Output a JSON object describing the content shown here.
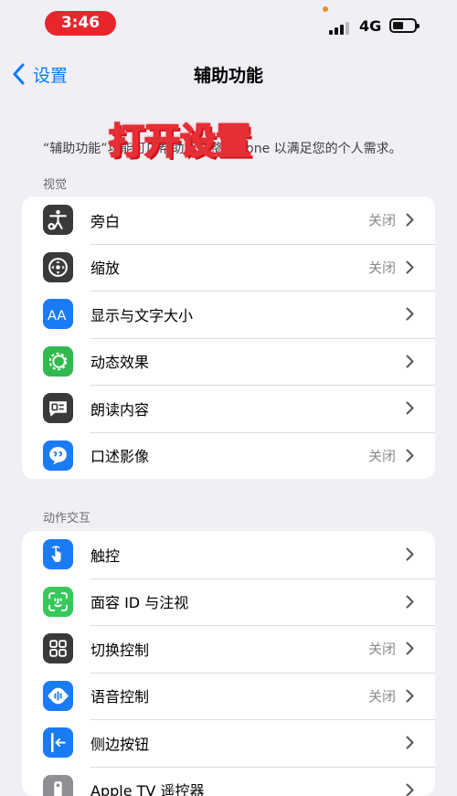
{
  "status": {
    "time": "3:46",
    "network": "4G"
  },
  "nav": {
    "back_label": "设置",
    "title": "辅助功能"
  },
  "description": "“辅助功能”功能可以帮助您调整 iPhone 以满足您的个人需求。",
  "overlay_text": "打开设置",
  "sections": [
    {
      "header": "视觉",
      "items": [
        {
          "label": "旁白",
          "value": "关闭",
          "icon": "voiceover-icon",
          "color": "#3a3a3c"
        },
        {
          "label": "缩放",
          "value": "关闭",
          "icon": "zoom-icon",
          "color": "#3a3a3c"
        },
        {
          "label": "显示与文字大小",
          "value": "",
          "icon": "text-size-icon",
          "color": "#1a7cf5"
        },
        {
          "label": "动态效果",
          "value": "",
          "icon": "motion-icon",
          "color": "#30b94e"
        },
        {
          "label": "朗读内容",
          "value": "",
          "icon": "spoken-content-icon",
          "color": "#3a3a3c"
        },
        {
          "label": "口述影像",
          "value": "关闭",
          "icon": "audio-description-icon",
          "color": "#1a7cf5"
        }
      ]
    },
    {
      "header": "动作交互",
      "items": [
        {
          "label": "触控",
          "value": "",
          "icon": "touch-icon",
          "color": "#1a7cf5"
        },
        {
          "label": "面容 ID 与注视",
          "value": "",
          "icon": "face-id-icon",
          "color": "#36c95a"
        },
        {
          "label": "切换控制",
          "value": "关闭",
          "icon": "switch-control-icon",
          "color": "#3a3a3c"
        },
        {
          "label": "语音控制",
          "value": "关闭",
          "icon": "voice-control-icon",
          "color": "#1a7cf5"
        },
        {
          "label": "侧边按钮",
          "value": "",
          "icon": "side-button-icon",
          "color": "#1a7cf5"
        },
        {
          "label": "Apple TV 遥控器",
          "value": "",
          "icon": "tv-remote-icon",
          "color": "#8e8e93"
        }
      ]
    }
  ]
}
